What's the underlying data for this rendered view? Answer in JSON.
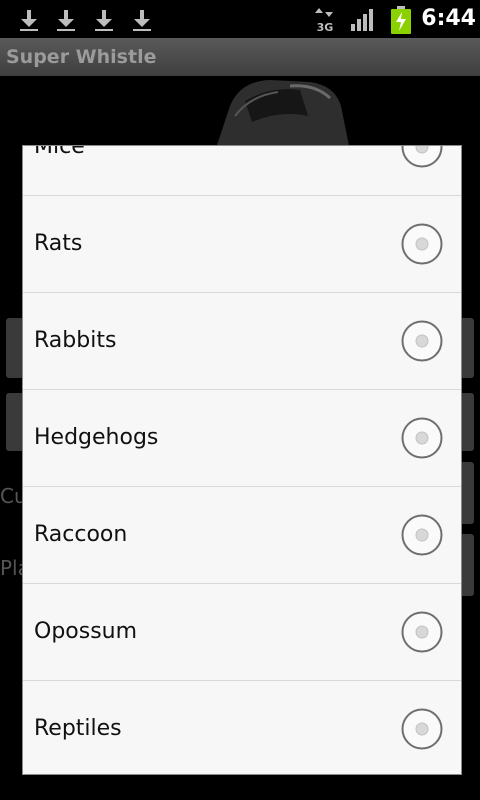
{
  "status_bar": {
    "time": "6:44",
    "network": "3G",
    "icons": [
      "download-icon",
      "download-icon",
      "download-icon",
      "download-icon",
      "network-3g-icon",
      "signal-icon",
      "battery-charging-icon"
    ]
  },
  "app": {
    "title": "Super Whistle"
  },
  "background": {
    "partial_text_1": "Cu",
    "partial_text_2": "Pla"
  },
  "dialog": {
    "options": [
      {
        "label": "Mice",
        "selected": false
      },
      {
        "label": "Rats",
        "selected": false
      },
      {
        "label": "Rabbits",
        "selected": false
      },
      {
        "label": "Hedgehogs",
        "selected": false
      },
      {
        "label": "Raccoon",
        "selected": false
      },
      {
        "label": "Opossum",
        "selected": false
      },
      {
        "label": "Reptiles",
        "selected": false
      }
    ]
  },
  "colors": {
    "dialog_bg": "#f7f7f7",
    "title_bar": "#4a4a4a",
    "title_text": "#9b9b9b",
    "battery_green": "#8bd100"
  }
}
